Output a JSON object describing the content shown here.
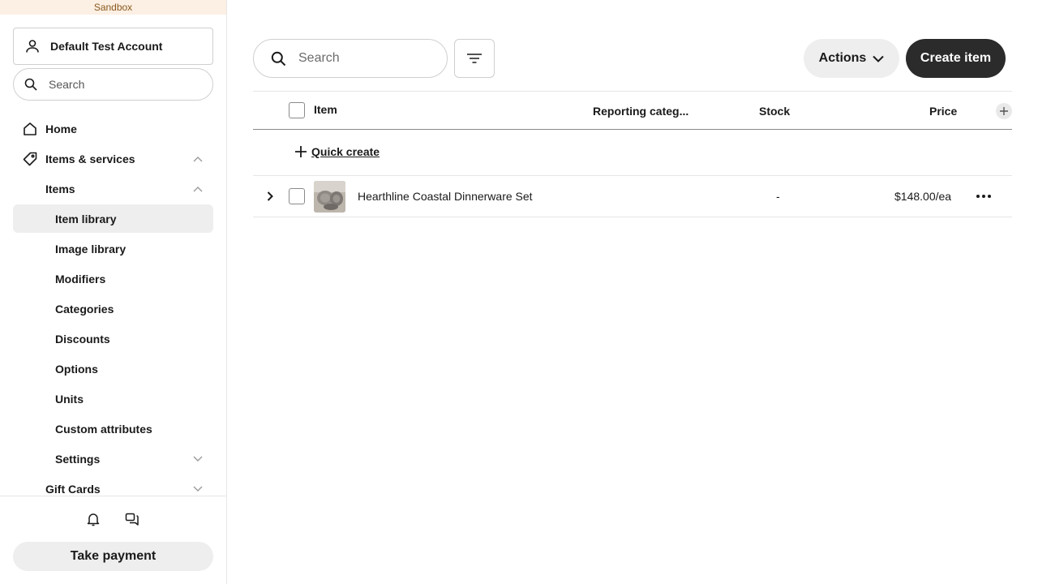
{
  "sandbox_label": "Sandbox",
  "account": {
    "name": "Default Test Account"
  },
  "sidebar": {
    "search_placeholder": "Search",
    "items": [
      {
        "label": "Home"
      },
      {
        "label": "Items & services"
      },
      {
        "label": "Items"
      },
      {
        "label": "Item library"
      },
      {
        "label": "Image library"
      },
      {
        "label": "Modifiers"
      },
      {
        "label": "Categories"
      },
      {
        "label": "Discounts"
      },
      {
        "label": "Options"
      },
      {
        "label": "Units"
      },
      {
        "label": "Custom attributes"
      },
      {
        "label": "Settings"
      },
      {
        "label": "Gift Cards"
      }
    ],
    "take_payment": "Take payment"
  },
  "toolbar": {
    "search_placeholder": "Search",
    "actions_label": "Actions",
    "create_label": "Create item"
  },
  "table": {
    "columns": {
      "item": "Item",
      "reporting": "Reporting categ...",
      "stock": "Stock",
      "price": "Price"
    },
    "quick_create": "Quick create",
    "rows": [
      {
        "name": "Hearthline Coastal Dinnerware Set",
        "stock": "-",
        "price": "$148.00/ea"
      }
    ]
  },
  "colors": {
    "accent_dark": "#2b2b2b",
    "sandbox_bg": "#fcefe3",
    "active_bg": "#eeeeee"
  }
}
